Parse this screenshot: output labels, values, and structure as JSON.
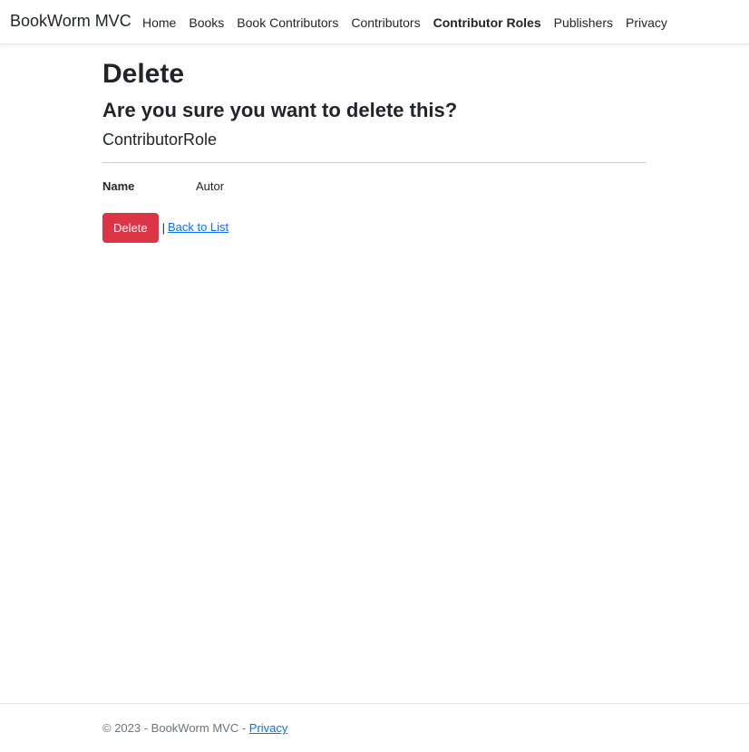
{
  "navbar": {
    "brand": "BookWorm MVC",
    "items": [
      {
        "label": "Home",
        "active": false
      },
      {
        "label": "Books",
        "active": false
      },
      {
        "label": "Book Contributors",
        "active": false
      },
      {
        "label": "Contributors",
        "active": false
      },
      {
        "label": "Contributor Roles",
        "active": true
      },
      {
        "label": "Publishers",
        "active": false
      },
      {
        "label": "Privacy",
        "active": false
      }
    ]
  },
  "page": {
    "title": "Delete",
    "question": "Are you sure you want to delete this?",
    "entity": "ContributorRole",
    "fields": [
      {
        "label": "Name",
        "value": "Autor"
      }
    ],
    "delete_button": "Delete",
    "separator": "|",
    "back_link": "Back to List"
  },
  "footer": {
    "copyright": "© 2023 - BookWorm MVC - ",
    "privacy_link": "Privacy"
  },
  "colors": {
    "danger": "#dc3545",
    "link": "#0d6efd",
    "text": "#212529",
    "muted": "#6c757d"
  }
}
